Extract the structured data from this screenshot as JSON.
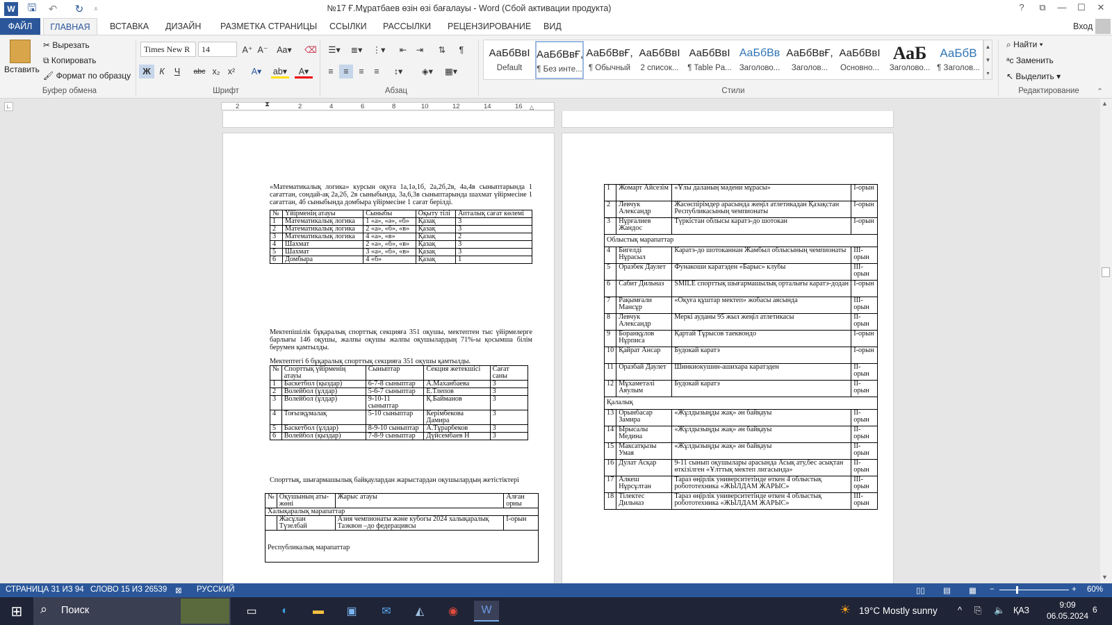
{
  "window": {
    "title": "№17 Ғ.Мұратбаев өзін өзі бағалауы - Word (Сбой активации продукта)",
    "help": "?",
    "restore_ribbon": "⧉",
    "minimize": "—",
    "maximize": "☐",
    "close": "✕",
    "login": "Вход"
  },
  "tabs": [
    "ФАЙЛ",
    "ГЛАВНАЯ",
    "ВСТАВКА",
    "ДИЗАЙН",
    "РАЗМЕТКА СТРАНИЦЫ",
    "ССЫЛКИ",
    "РАССЫЛКИ",
    "РЕЦЕНЗИРОВАНИЕ",
    "ВИД"
  ],
  "clipboard": {
    "paste": "Вставить",
    "cut": "Вырезать",
    "copy": "Копировать",
    "format_painter": "Формат по образцу",
    "label": "Буфер обмена"
  },
  "font": {
    "name": "Times New R",
    "size": "14",
    "bold": "Ж",
    "italic": "К",
    "underline": "Ч",
    "strike": "abc",
    "sub": "x₂",
    "sup": "x²",
    "label": "Шрифт"
  },
  "paragraph": {
    "label": "Абзац"
  },
  "styles": {
    "label": "Стили",
    "items": [
      {
        "preview": "АаБбВвІ",
        "name": "Default"
      },
      {
        "preview": "АаБбВвҒ,",
        "name": "¶ Без инте..."
      },
      {
        "preview": "АаБбВвҒ,",
        "name": "¶ Обычный"
      },
      {
        "preview": "АаБбВвІ",
        "name": "2 список..."
      },
      {
        "preview": "АаБбВвІ",
        "name": "¶ Table Pa..."
      },
      {
        "preview": "АаБбВв",
        "name": "Заголово..."
      },
      {
        "preview": "АаБбВвҒ,",
        "name": "Заголов..."
      },
      {
        "preview": "АаБбВвІ",
        "name": "Основно..."
      },
      {
        "preview": "АаБ",
        "name": "Заголово..."
      },
      {
        "preview": "АаБбВ",
        "name": "¶ Заголов..."
      }
    ]
  },
  "editing": {
    "find": "Найти",
    "replace": "Заменить",
    "select": "Выделить",
    "label": "Редактирование"
  },
  "ruler": {
    "ticks": [
      "2",
      "",
      "2",
      "4",
      "6",
      "8",
      "10",
      "12",
      "14",
      "16"
    ]
  },
  "left_page": {
    "intro": "«Математикалық логика» курсын оқуға 1а,1ә,1б, 2а,2б,2в, 4а,4в сыныптарында 1 сағаттан, сондай-ақ 2а,2б, 2в сыныбында, 3а,6,3в сыныптарында шахмат үйірмесіне 1 сағаттан, 4б сыныбында домбыра үйірмесіне 1 сағат берілді.",
    "t1_head": [
      "№",
      "Үйірменің атауы",
      "Сыныбы",
      "Оқыту тілі",
      "Апталық сағат көлемі"
    ],
    "t1_rows": [
      [
        "1",
        "Математикалық логика",
        "1 «а», «ә», «б»",
        "Қазақ",
        "3"
      ],
      [
        "2",
        "Математикалық логика",
        "2 «а», «б», «в»",
        "Қазақ",
        "3"
      ],
      [
        "3",
        "Математикалық логика",
        "4 «а», «в»",
        "Қазақ",
        "2"
      ],
      [
        "4",
        "Шахмат",
        "2 «а», «б», «в»",
        "Қазақ",
        "3"
      ],
      [
        "5",
        "Шахмат",
        "3 «а», «б», «в»",
        "Қазақ",
        "3"
      ],
      [
        "6",
        "Домбыра",
        "4 «б»",
        "Қазақ",
        "1"
      ]
    ],
    "para2": "Мектепішілік бұқаралық спорттық секцияға 351 оқушы, мектептен тыс үйірмелерге барлығы 146 оқушы, жалпы оқушы жалпы оқушылардың 71%-ы қосымша білім берумен қамтылды.",
    "para3": "Мектептегі 6 бұқаралық спорттық секцияға 351 оқушы қамтылды.",
    "t2_head": [
      "№",
      "Спорттық үйірменің атауы",
      "Сыныптар",
      "Секция жетекшісі",
      "Сағат саны"
    ],
    "t2_rows": [
      [
        "1",
        "Баскетбол (қыздар)",
        "6-7-8 сыныптар",
        "А.Маханбаева",
        "3"
      ],
      [
        "2",
        "Волейбол (ұлдар)",
        "5-6-7 сыныптар",
        "Е.Тлепов",
        "3"
      ],
      [
        "3",
        "Волейбол (ұлдар)",
        "9-10-11 сыныптар",
        "Қ.Байманов",
        "3"
      ],
      [
        "4",
        "Тоғызқұмалақ",
        "5-10 сыныптар",
        "Керімбекова Дамира",
        "3"
      ],
      [
        "5",
        "Баскетбол (ұлдар)",
        "8-9-10 сыныптар",
        "А.Тұрарбеков",
        "3"
      ],
      [
        "6",
        "Волейбол (қыздар)",
        "7-8-9 сыныптар",
        "Дүйсембаев Н",
        "3"
      ]
    ],
    "para4": "Спорттық, шығармашылық байқаулардан жарыстардан оқушылардың жетістіктері",
    "t3_head": [
      "№",
      "Оқушының аты-жөні",
      "Жарыс атауы",
      "Алған орны"
    ],
    "t3_section": "Халықаралық марапаттар",
    "t3_row": [
      "Жасұлан Түзелбай",
      "Азия чемпионаты және кубогы 2024 халықаралық Таэквон –до федерациясы",
      "І-орын"
    ],
    "t3_section2": "Республикалық марапаттар"
  },
  "right_page": {
    "rows": [
      {
        "n": "1",
        "name": "Жомарт Айсезім",
        "event": "«Ұлы даланың мәдени мұрасы»",
        "place": "І-орын"
      },
      {
        "n": "2",
        "name": "Левчук Александр",
        "event": "Жасөспірімдер арасында жеңіл атлетикадан Қазақстан Республикасының чемпионаты",
        "place": "І-орын"
      },
      {
        "n": "3",
        "name": "Нұрғалиев Жандос",
        "event": "Түркістан облысы каратэ-до шотокан",
        "place": "І-орын"
      },
      {
        "section": "Облыстық марапаттар"
      },
      {
        "n": "4",
        "name": "Бигелді Нұрасыл",
        "event": "Каратэ-до шотоканнан Жамбыл облысының чемпионаты",
        "place": "ІІІ-орын"
      },
      {
        "n": "5",
        "name": "Оразбек Даулет",
        "event": "Фунакоши каратэден «Барыс» клубы",
        "place": "ІІІ-орын"
      },
      {
        "n": "6",
        "name": "Сабит Дильназ",
        "event": "SMILE спорттық шығармашылық орталығы каратэ-додан",
        "place": "І-орын"
      },
      {
        "n": "7",
        "name": "Рақымғали Мансұр",
        "event": "«Оқуға құштар мектеп» жобасы аясында",
        "place": "ІІІ- орын"
      },
      {
        "n": "8",
        "name": "Левчук Александр",
        "event": "Меркі ауданы 95 жыл жеңіл атлетикасы",
        "place": "ІІ-орын"
      },
      {
        "n": "9",
        "name": "Боранқұлов Нұрписа",
        "event": "Қартай Тұрысов таеквондо",
        "place": "І-орын"
      },
      {
        "n": "10",
        "name": "Қайрат Ансар",
        "event": "Будокай каратэ",
        "place": "І-орын"
      },
      {
        "n": "11",
        "name": "Оразбай Даулет",
        "event": "Шинкиокушин-ашихара каратэден",
        "place": "ІІ-орын"
      },
      {
        "n": "12",
        "name": "Мұхаметәлі Аяулым",
        "event": "Будокай каратэ",
        "place": "ІІ-орын"
      },
      {
        "section": "Қалалық"
      },
      {
        "n": "13",
        "name": "Орынбасар Замира",
        "event": "«Жұлдызыңды жақ» ән байқауы",
        "place": "ІІ-орын"
      },
      {
        "n": "14",
        "name": "Ырысалы Медина",
        "event": "«Жұлдызыңды жақ» ән байқауы",
        "place": "ІІ-орын"
      },
      {
        "n": "15",
        "name": "Максатқызы Умая",
        "event": "«Жұлдызыңды жақ» ән байқауы",
        "place": "ІІ-орын"
      },
      {
        "n": "16",
        "name": "Дулат Асқар",
        "event": "9-11 сынып оқушылары арасында Асық ату,бес асықтан өткізілген «Ұлттық мектеп лигасында»",
        "place": "ІІ-орын"
      },
      {
        "n": "17",
        "name": "Алкеш Нұрсұлтан",
        "event": "Тараз өңірлік университетінде өткен 4 облыстық робототехника «ЖЫЛДАМ ЖАРЫС»",
        "place": "ІІІ-орын"
      },
      {
        "n": "18",
        "name": "Тілектес Дильназ",
        "event": "Тараз өңірлік университетінде өткен 4 облыстық робототехника «ЖЫЛДАМ ЖАРЫС»",
        "place": "ІІІ-орын"
      }
    ]
  },
  "status": {
    "page": "СТРАНИЦА 31 ИЗ 94",
    "words": "СЛОВО 15 ИЗ 26539",
    "lang": "РУССКИЙ",
    "zoom": "60%"
  },
  "taskbar": {
    "search": "Поиск",
    "weather": "19°C Mostly sunny",
    "lang": "ҚАЗ",
    "time": "9:09",
    "date": "06.05.2024",
    "notif": "6"
  }
}
